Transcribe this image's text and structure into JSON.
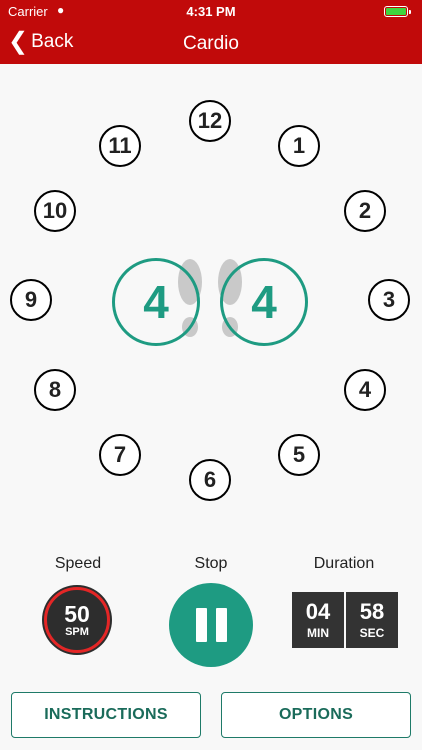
{
  "status_bar": {
    "carrier": "Carrier",
    "wifi_icon": "wifi-icon",
    "time": "4:31 PM",
    "battery_icon": "battery-icon"
  },
  "nav": {
    "back_label": "Back",
    "title": "Cardio"
  },
  "clock": {
    "numbers": [
      "12",
      "1",
      "2",
      "3",
      "4",
      "5",
      "6",
      "7",
      "8",
      "9",
      "10",
      "11"
    ],
    "left_count": "4",
    "right_count": "4",
    "footprints_icon": "footprints-icon"
  },
  "controls": {
    "speed_label": "Speed",
    "speed_value": "50",
    "speed_unit": "SPM",
    "stop_label": "Stop",
    "duration_label": "Duration",
    "minutes": "04",
    "minutes_unit": "MIN",
    "seconds": "58",
    "seconds_unit": "SEC"
  },
  "buttons": {
    "instructions": "INSTRUCTIONS",
    "options": "OPTIONS"
  },
  "colors": {
    "header": "#c10a0a",
    "accent": "#1e9b82",
    "speed_ring": "#e42626",
    "tile": "#333333"
  }
}
